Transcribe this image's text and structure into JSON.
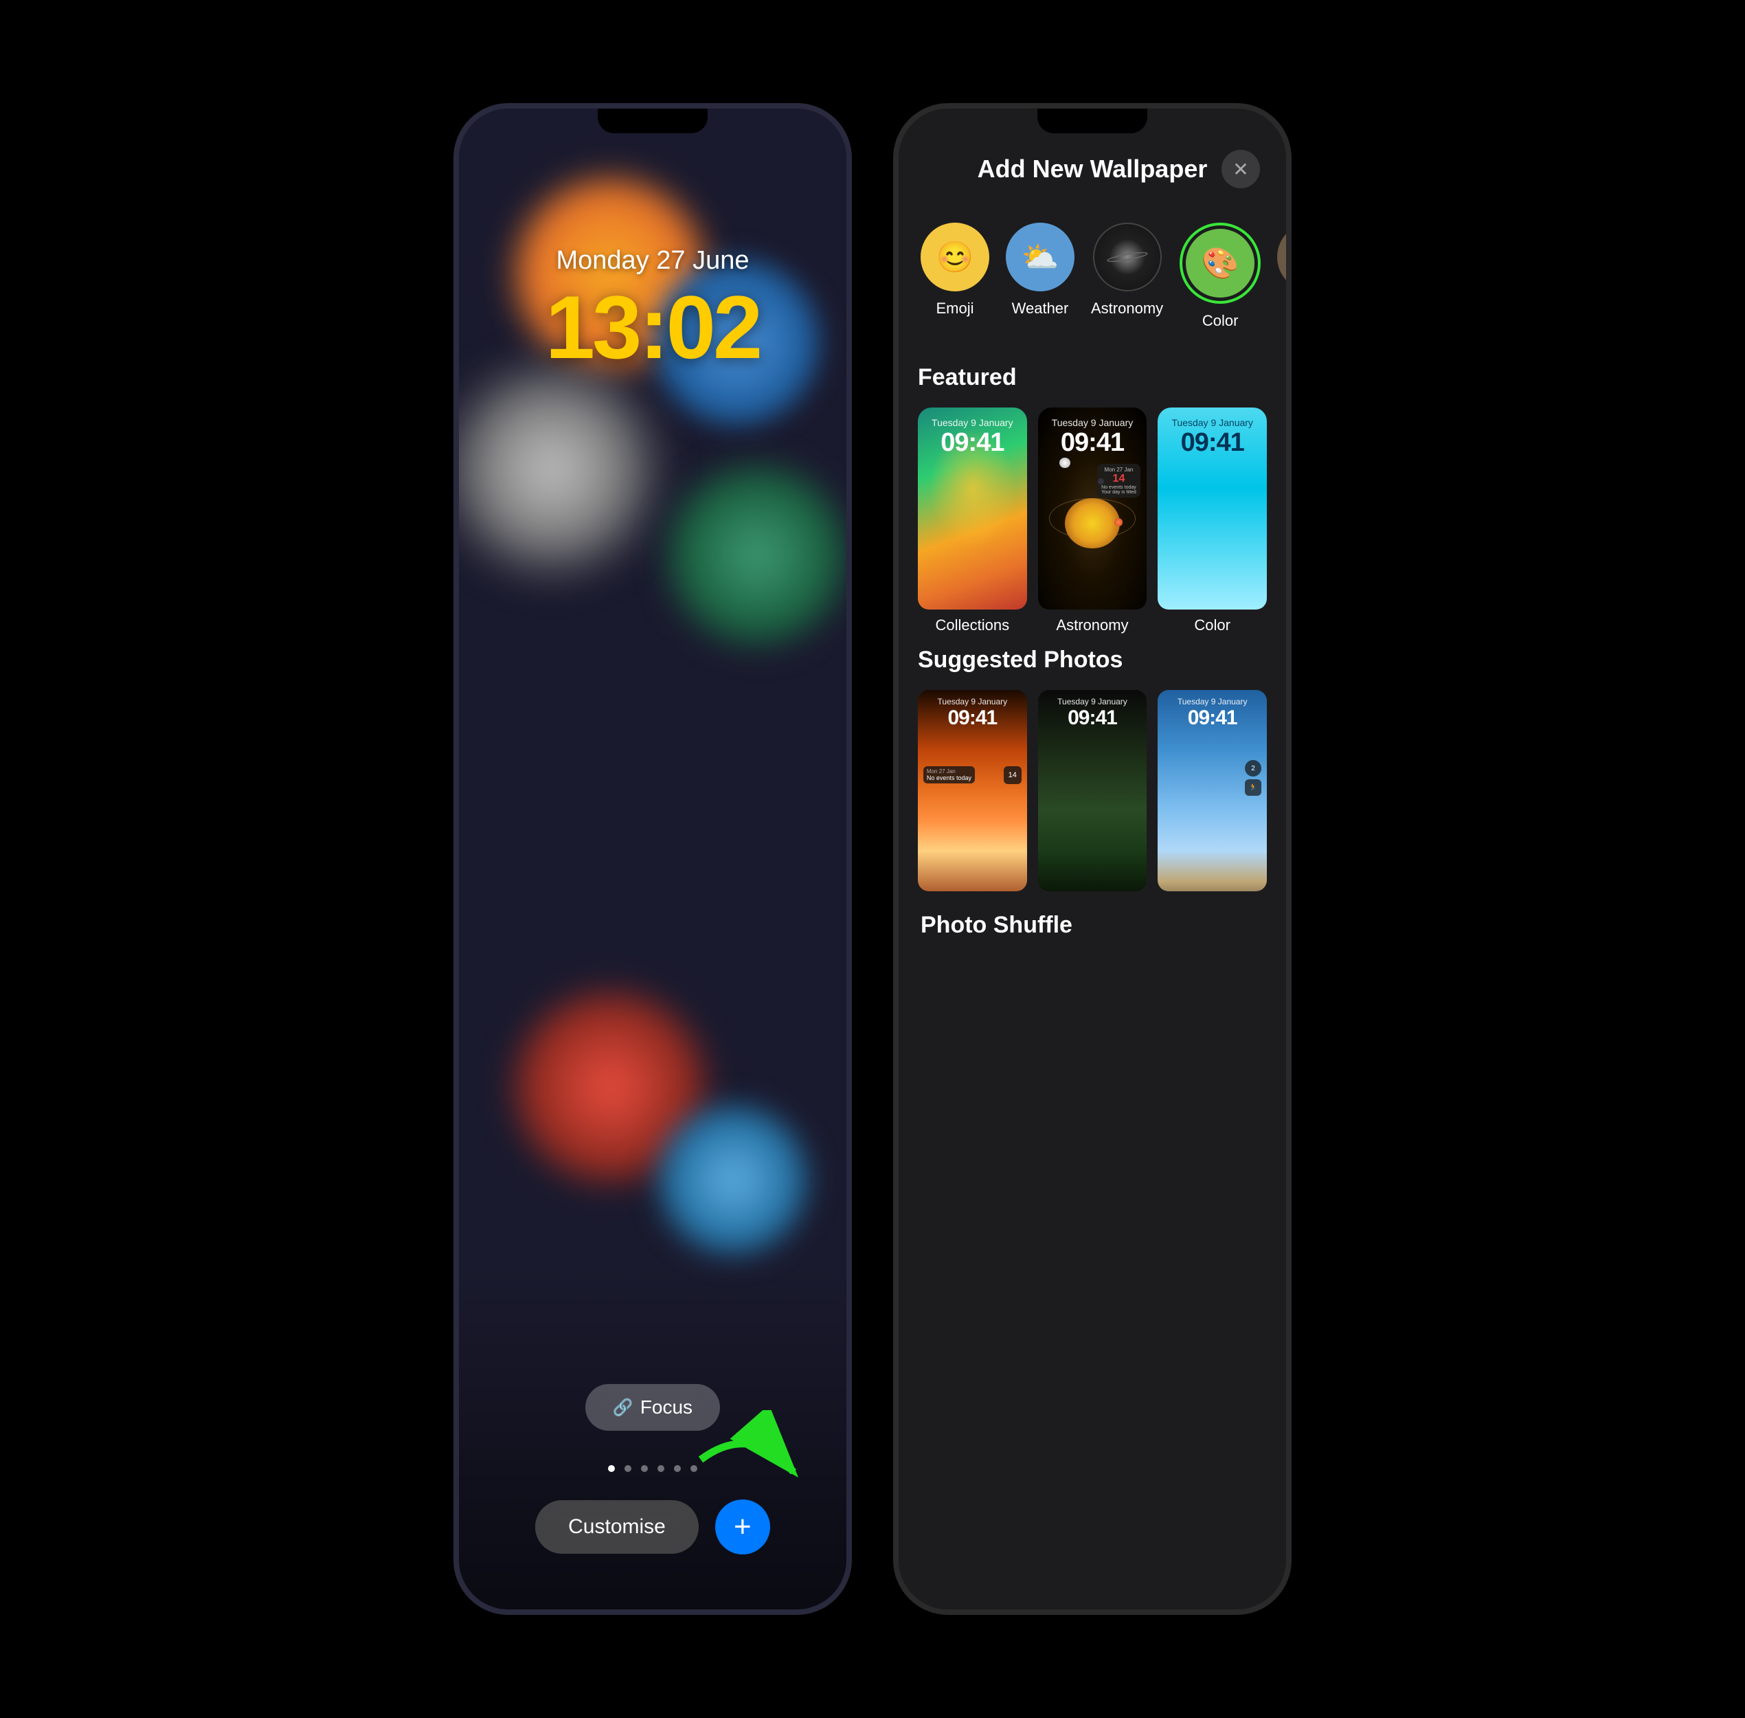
{
  "left_phone": {
    "lock_screen": {
      "date": "Monday 27 June",
      "time": "13:02",
      "focus_label": "Focus",
      "dots": [
        "active",
        "inactive",
        "inactive",
        "inactive",
        "inactive",
        "inactive"
      ],
      "customise_label": "Customise",
      "add_icon": "+"
    }
  },
  "right_phone": {
    "panel": {
      "title": "Add New Wallpaper",
      "close_icon": "✕",
      "categories": [
        {
          "id": "emoji",
          "label": "Emoji",
          "icon": "😊"
        },
        {
          "id": "weather",
          "label": "Weather",
          "icon": "⛅"
        },
        {
          "id": "astronomy",
          "label": "Astronomy",
          "icon": "🔭"
        },
        {
          "id": "color",
          "label": "Color",
          "icon": "🎨",
          "selected": true
        }
      ],
      "featured_label": "Featured",
      "featured_items": [
        {
          "id": "collections",
          "label": "Collections",
          "date": "Tuesday 9 January",
          "time": "09:41"
        },
        {
          "id": "astronomy",
          "label": "Astronomy",
          "date": "Tuesday 9 January",
          "time": "09:41"
        },
        {
          "id": "color",
          "label": "Color",
          "date": "Tuesday 9 January",
          "time": "09:41"
        }
      ],
      "suggested_photos_label": "Suggested Photos",
      "suggested_items": [
        {
          "id": "sunset",
          "date": "Tuesday 9 January",
          "time": "09:41"
        },
        {
          "id": "forest",
          "date": "Tuesday 9 January",
          "time": "09:41"
        },
        {
          "id": "skyblue",
          "date": "Tuesday 9 January",
          "time": "09:41"
        }
      ],
      "photo_shuffle_label": "Photo Shuffle"
    }
  }
}
